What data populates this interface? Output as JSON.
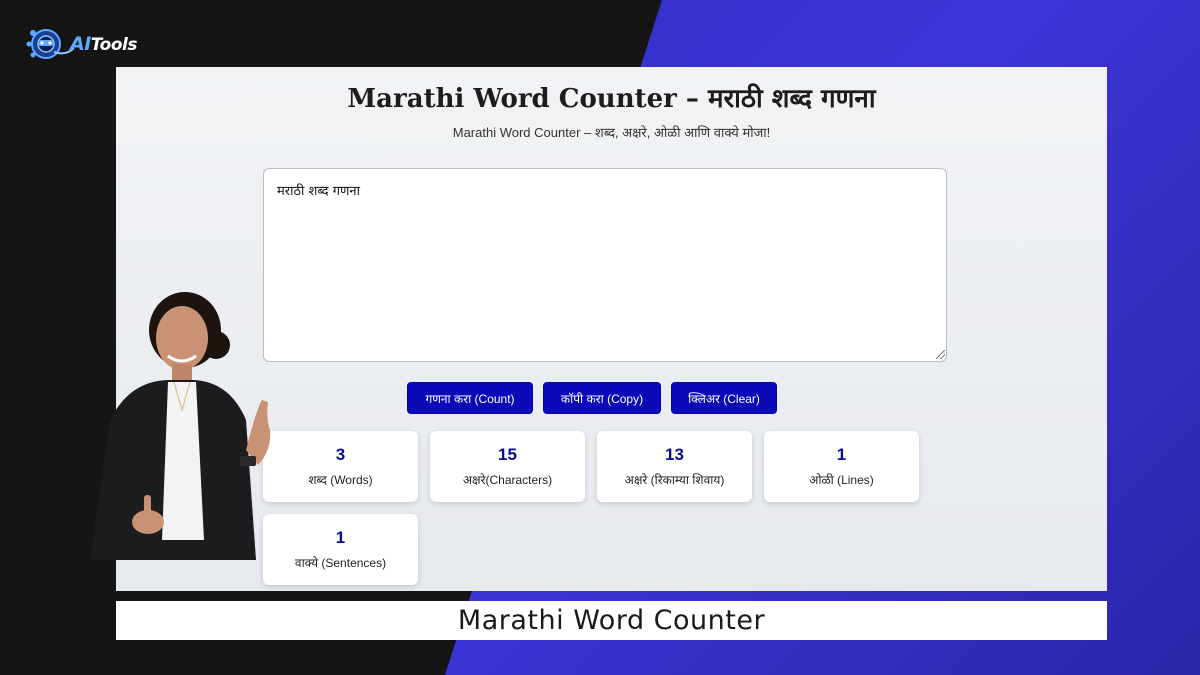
{
  "logo": {
    "brand_ai": "AI",
    "brand_rest": "Tools"
  },
  "header": {
    "title": "Marathi Word Counter – मराठी शब्द गणना",
    "subtitle": "Marathi Word Counter – शब्द, अक्षरे, ओळी आणि वाक्ये मोजा!"
  },
  "editor": {
    "value": "मराठी शब्द गणना"
  },
  "buttons": {
    "count": "गणना करा (Count)",
    "copy": "कॉपी करा (Copy)",
    "clear": "क्लिअर (Clear)"
  },
  "stats": [
    {
      "value": "3",
      "label": "शब्द (Words)"
    },
    {
      "value": "15",
      "label": "अक्षरे(Characters)"
    },
    {
      "value": "13",
      "label": "अक्षरे (रिकाम्या शिवाय)"
    },
    {
      "value": "1",
      "label": "ओळी (Lines)"
    },
    {
      "value": "1",
      "label": "वाक्ये (Sentences)"
    }
  ],
  "caption": "Marathi Word Counter",
  "colors": {
    "accent": "#0a0ab8",
    "stat_value": "#0a0a9a",
    "bg_dark": "#151515",
    "bg_blue": "#3c35d8"
  }
}
